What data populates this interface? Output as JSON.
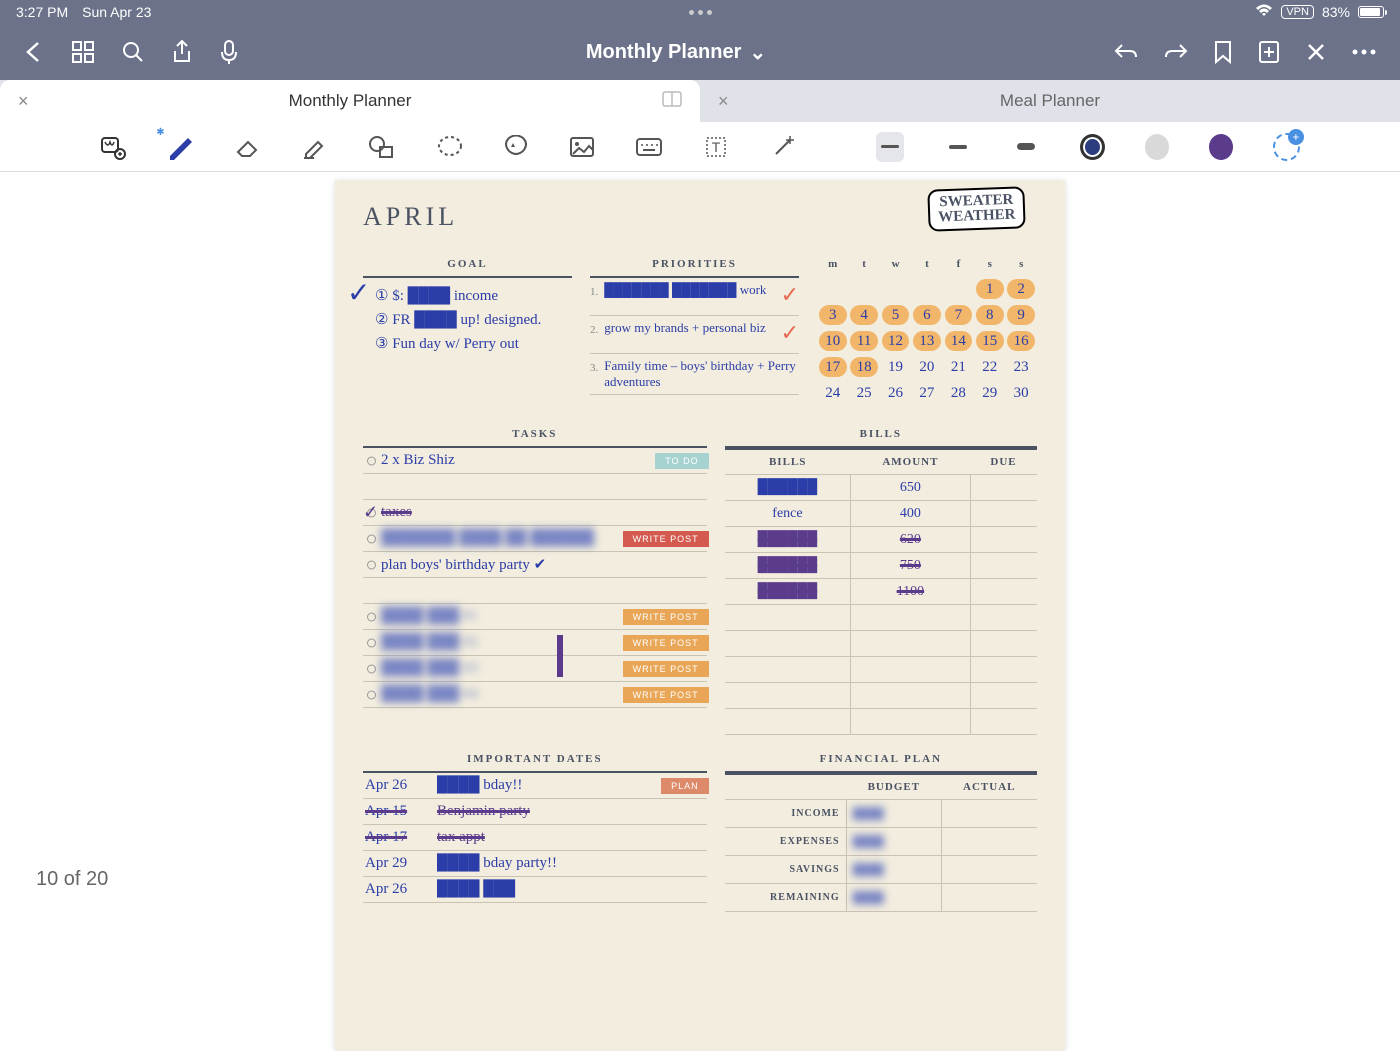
{
  "status": {
    "time": "3:27 PM",
    "date": "Sun Apr 23",
    "vpn": "VPN",
    "battery_pct": "83%"
  },
  "nav": {
    "title": "Monthly Planner"
  },
  "tabs": {
    "active": "Monthly Planner",
    "inactive": "Meal Planner"
  },
  "page_counter": "10 of 20",
  "planner": {
    "month": "APRIL",
    "sticker_line1": "SWEATER",
    "sticker_line2": "WEATHER",
    "headers": {
      "goal": "GOAL",
      "priorities": "PRIORITIES",
      "tasks": "TASKS",
      "bills": "BILLS",
      "dates": "IMPORTANT DATES",
      "fin": "FINANCIAL PLAN"
    },
    "goals": [
      "① $: ████ income",
      "② FR ████ up! designed.",
      "③ Fun day w/ Perry out"
    ],
    "priorities": [
      {
        "n": "1.",
        "text": "███████ ███████ work",
        "check": true
      },
      {
        "n": "2.",
        "text": "grow my brands + personal biz",
        "check": true
      },
      {
        "n": "3.",
        "text": "Family time – boys' birthday + Perry adventures",
        "check": false
      }
    ],
    "cal_days": [
      "m",
      "t",
      "w",
      "t",
      "f",
      "s",
      "s"
    ],
    "cal_cells": [
      {
        "d": "",
        "hl": false
      },
      {
        "d": "",
        "hl": false
      },
      {
        "d": "",
        "hl": false
      },
      {
        "d": "",
        "hl": false
      },
      {
        "d": "",
        "hl": false
      },
      {
        "d": "1",
        "hl": true
      },
      {
        "d": "2",
        "hl": true
      },
      {
        "d": "3",
        "hl": true
      },
      {
        "d": "4",
        "hl": true
      },
      {
        "d": "5",
        "hl": true
      },
      {
        "d": "6",
        "hl": true
      },
      {
        "d": "7",
        "hl": true
      },
      {
        "d": "8",
        "hl": true
      },
      {
        "d": "9",
        "hl": true
      },
      {
        "d": "10",
        "hl": true
      },
      {
        "d": "11",
        "hl": true
      },
      {
        "d": "12",
        "hl": true
      },
      {
        "d": "13",
        "hl": true
      },
      {
        "d": "14",
        "hl": true
      },
      {
        "d": "15",
        "hl": true
      },
      {
        "d": "16",
        "hl": true
      },
      {
        "d": "17",
        "hl": true
      },
      {
        "d": "18",
        "hl": true
      },
      {
        "d": "19",
        "hl": false
      },
      {
        "d": "20",
        "hl": false
      },
      {
        "d": "21",
        "hl": false
      },
      {
        "d": "22",
        "hl": false
      },
      {
        "d": "23",
        "hl": false
      },
      {
        "d": "24",
        "hl": false
      },
      {
        "d": "25",
        "hl": false
      },
      {
        "d": "26",
        "hl": false
      },
      {
        "d": "27",
        "hl": false
      },
      {
        "d": "28",
        "hl": false
      },
      {
        "d": "29",
        "hl": false
      },
      {
        "d": "30",
        "hl": false
      }
    ],
    "tasks": [
      {
        "text": "2 x Biz Shiz",
        "tag": "TO DO",
        "tagClass": "tag-teal"
      },
      {
        "text": ""
      },
      {
        "text": "taxes",
        "strike": true,
        "purple": true,
        "check": true
      },
      {
        "text": "███████ ████ ██ ██████",
        "tag": "WRITE POST",
        "tagClass": "tag-red",
        "blur": true
      },
      {
        "text": "plan boys' birthday party ✔"
      },
      {
        "text": ""
      },
      {
        "text": "████ ███  #1",
        "tag": "WRITE POST",
        "tagClass": "tag-orange",
        "blur": true
      },
      {
        "text": "████ ███  #2",
        "tag": "WRITE POST",
        "tagClass": "tag-orange",
        "blur": true
      },
      {
        "text": "████ ███  #3",
        "tag": "WRITE POST",
        "tagClass": "tag-orange",
        "blur": true
      },
      {
        "text": "████ ███  #4",
        "tag": "WRITE POST",
        "tagClass": "tag-orange",
        "blur": true
      }
    ],
    "bills_header": {
      "bills": "BILLS",
      "amount": "AMOUNT",
      "due": "DUE"
    },
    "bills": [
      {
        "name": "██████",
        "amt": "650"
      },
      {
        "name": "fence",
        "amt": "400"
      },
      {
        "name": "██████",
        "amt": "620",
        "strike": true
      },
      {
        "name": "██████",
        "amt": "750",
        "strike": true
      },
      {
        "name": "██████",
        "amt": "1100",
        "strike": true
      },
      {
        "name": "",
        "amt": ""
      },
      {
        "name": "",
        "amt": ""
      },
      {
        "name": "",
        "amt": ""
      },
      {
        "name": "",
        "amt": ""
      },
      {
        "name": "",
        "amt": ""
      }
    ],
    "dates": [
      {
        "d": "Apr 26",
        "t": "████ bday!!",
        "tag": "PLAN",
        "tagClass": "tag-coral"
      },
      {
        "d": "Apr 15",
        "t": "Benjamin party",
        "strike": true
      },
      {
        "d": "Apr 17",
        "t": "tax appt",
        "strike": true
      },
      {
        "d": "Apr 29",
        "t": "████ bday party!!"
      },
      {
        "d": "Apr 26",
        "t": "████ ███"
      }
    ],
    "fin_header": {
      "budget": "BUDGET",
      "actual": "ACTUAL"
    },
    "fin_rows": [
      "INCOME",
      "EXPENSES",
      "SAVINGS",
      "REMAINING"
    ]
  }
}
